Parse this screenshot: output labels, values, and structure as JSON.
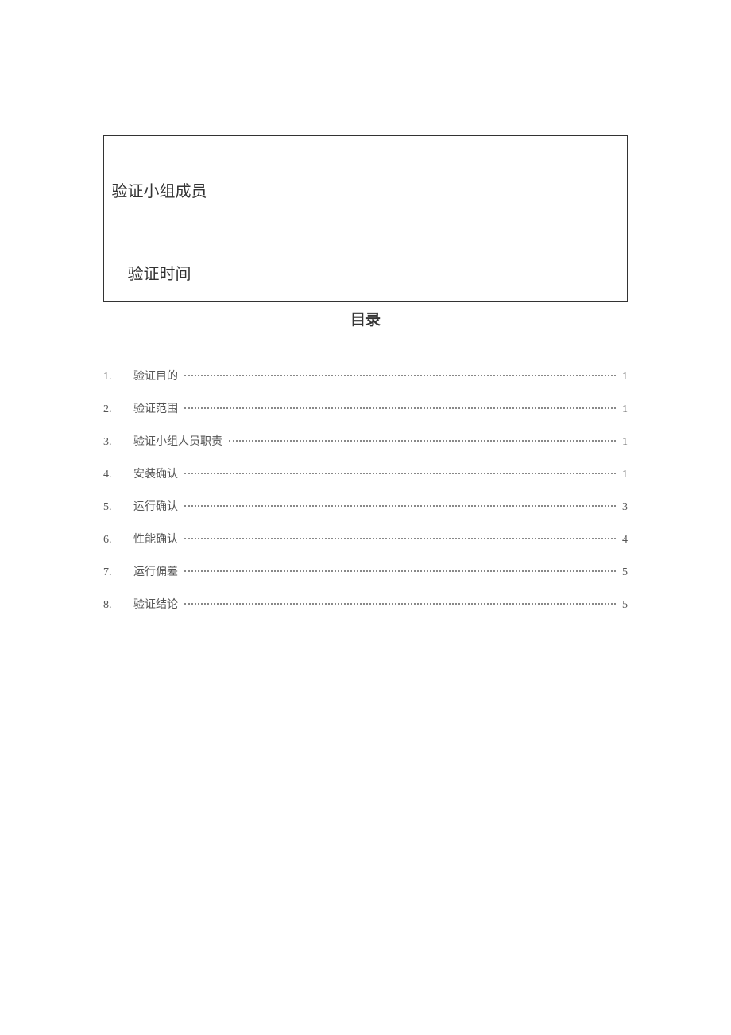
{
  "info_rows": [
    {
      "label": "验证小组成员",
      "value": ""
    },
    {
      "label": "验证时间",
      "value": ""
    }
  ],
  "toc_title": "目录",
  "toc": [
    {
      "num": "1.",
      "label": "验证目的",
      "page": "1"
    },
    {
      "num": "2.",
      "label": "验证范围",
      "page": "1"
    },
    {
      "num": "3.",
      "label": "验证小组人员职责",
      "page": "1"
    },
    {
      "num": "4.",
      "label": "安装确认",
      "page": "1"
    },
    {
      "num": "5.",
      "label": "运行确认",
      "page": "3"
    },
    {
      "num": "6.",
      "label": "性能确认",
      "page": "4"
    },
    {
      "num": "7.",
      "label": "运行偏差",
      "page": "5"
    },
    {
      "num": "8.",
      "label": "验证结论",
      "page": "5"
    }
  ]
}
